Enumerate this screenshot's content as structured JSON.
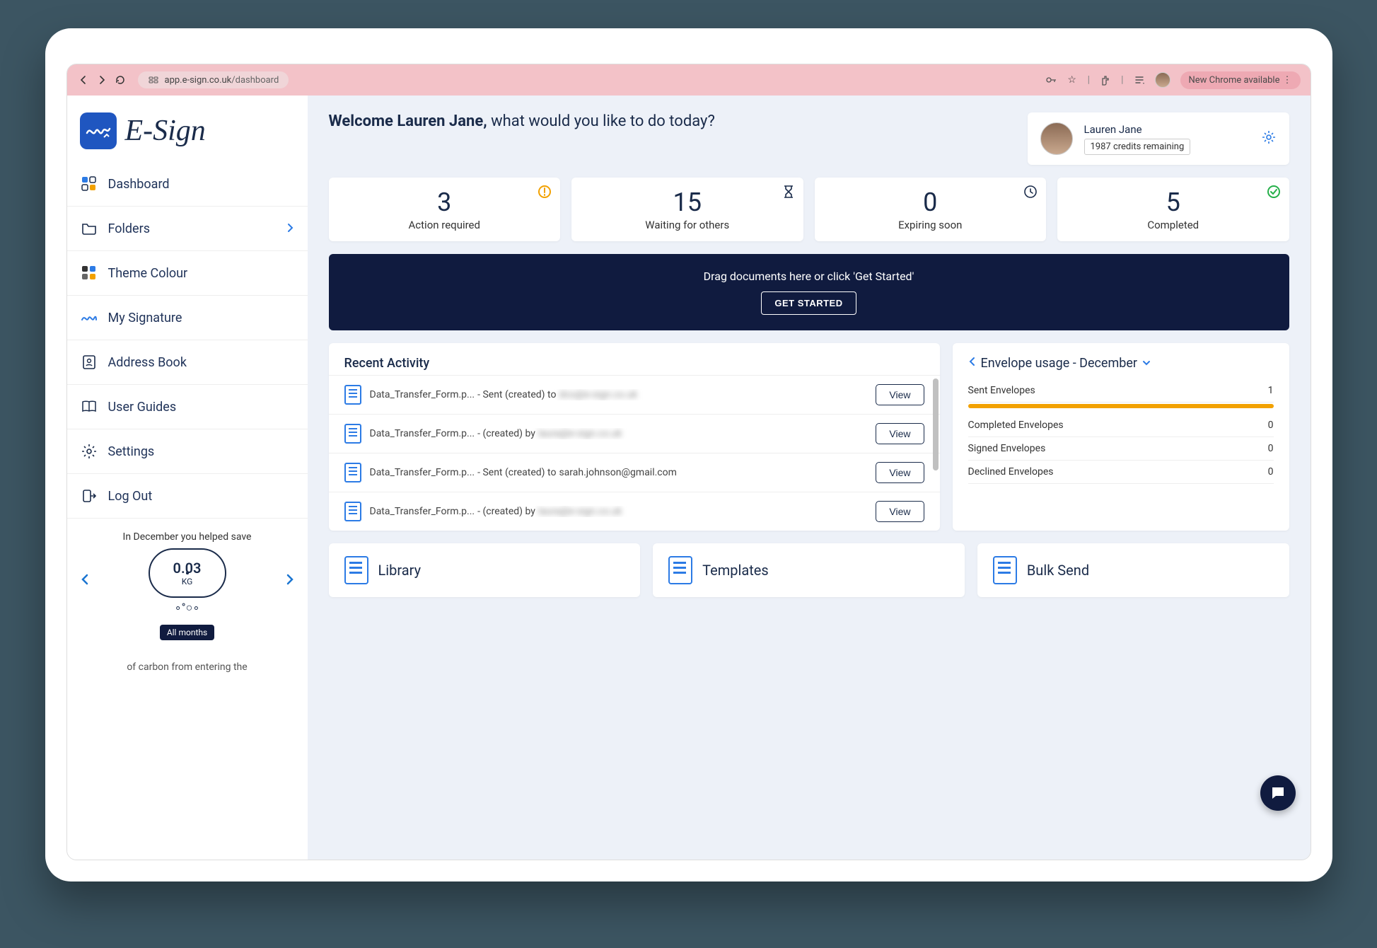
{
  "browser": {
    "url_domain": "app.e-sign.co.uk",
    "url_path": "/dashboard",
    "new_chrome": "New Chrome available"
  },
  "logo_text": "E-Sign",
  "sidebar": {
    "items": [
      {
        "label": "Dashboard"
      },
      {
        "label": "Folders"
      },
      {
        "label": "Theme Colour"
      },
      {
        "label": "My Signature"
      },
      {
        "label": "Address Book"
      },
      {
        "label": "User Guides"
      },
      {
        "label": "Settings"
      },
      {
        "label": "Log Out"
      }
    ],
    "carbon_intro": "In December you helped save",
    "carbon_value": "0.03",
    "carbon_unit": "KG",
    "all_months": "All months",
    "carbon_footer": "of carbon from entering the"
  },
  "welcome": {
    "bold": "Welcome Lauren Jane,",
    "rest": " what would you like to do today?"
  },
  "user": {
    "name": "Lauren Jane",
    "credits": "1987 credits remaining"
  },
  "stats": [
    {
      "num": "3",
      "label": "Action required"
    },
    {
      "num": "15",
      "label": "Waiting for others"
    },
    {
      "num": "0",
      "label": "Expiring soon"
    },
    {
      "num": "5",
      "label": "Completed"
    }
  ],
  "dropzone": {
    "text": "Drag documents here or click 'Get Started'",
    "button": "GET STARTED"
  },
  "recent": {
    "title": "Recent Activity",
    "items": [
      {
        "file": "Data_Transfer_Form.p... ",
        "mid": "- Sent (created) to ",
        "tail": "dco@e-sign.co.uk",
        "blurred": true
      },
      {
        "file": "Data_Transfer_Form.p... ",
        "mid": "- (created) by ",
        "tail": "laura@e-sign.co.uk",
        "blurred": true
      },
      {
        "file": "Data_Transfer_Form.p... ",
        "mid": "- Sent (created) to ",
        "tail": "sarah.johnson@gmail.com",
        "blurred": false
      },
      {
        "file": "Data_Transfer_Form.p... ",
        "mid": "- (created) by ",
        "tail": "laura@e-sign.co.uk",
        "blurred": true
      }
    ],
    "view_label": "View"
  },
  "usage": {
    "title_prefix": "Envelope usage - ",
    "month": "December",
    "rows": [
      {
        "label": "Sent Envelopes",
        "value": "1",
        "bar": true
      },
      {
        "label": "Completed Envelopes",
        "value": "0"
      },
      {
        "label": "Signed Envelopes",
        "value": "0"
      },
      {
        "label": "Declined Envelopes",
        "value": "0"
      }
    ]
  },
  "tiles": [
    {
      "label": "Library"
    },
    {
      "label": "Templates"
    },
    {
      "label": "Bulk Send"
    }
  ]
}
